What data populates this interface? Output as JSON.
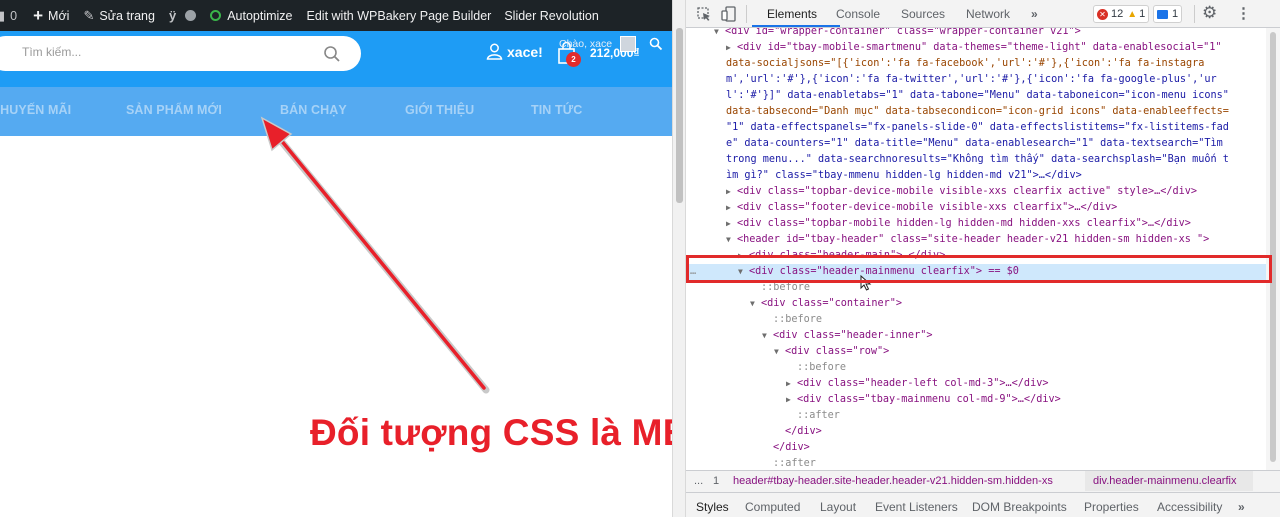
{
  "adminbar": {
    "comments_count": "0",
    "new_label": "Mới",
    "edit_label": "Sửa trang",
    "autoptimize_label": "Autoptimize",
    "wpbakery_label": "Edit with WPBakery Page Builder",
    "slider_label": "Slider Revolution"
  },
  "header": {
    "search_placeholder": "Tìm kiếm...",
    "account_name": "xace!",
    "cart_greeting": "Chào, xace",
    "cart_count": "2",
    "cart_total": "212,000₫"
  },
  "nav": {
    "items": [
      "KHUYẾN MÃI",
      "SẢN PHẨM MỚI",
      "BÁN CHẠY",
      "GIỚI THIỆU",
      "TIN TỨC"
    ]
  },
  "annotation": {
    "caption": "Đối tượng CSS là MENU",
    "color": "#e8202a"
  },
  "devtools": {
    "tabs": [
      "Elements",
      "Console",
      "Sources",
      "Network",
      "»"
    ],
    "errors": "12",
    "warnings": "1",
    "messages": "1",
    "dom_lines": [
      "<div id=\"wrapper-container\" class=\"wrapper-container v21\">",
      "<div id=\"tbay-mobile-smartmenu\" data-themes=\"theme-light\" data-enablesocial=\"1\"",
      "data-socialjsons=\"[{'icon':'fa fa-facebook','url':'#'},{'icon':'fa fa-instagra",
      "m','url':'#'},{'icon':'fa fa-twitter','url':'#'},{'icon':'fa fa-google-plus','ur",
      "l':'#'}]\" data-enabletabs=\"1\" data-tabone=\"Menu\" data-taboneicon=\"icon-menu icons\"",
      "data-tabsecond=\"Danh mục\" data-tabsecondicon=\"icon-grid icons\" data-enableeffects=",
      "\"1\" data-effectspanels=\"fx-panels-slide-0\" data-effectslistitems=\"fx-listitems-fad",
      "e\" data-counters=\"1\" data-title=\"Menu\" data-enablesearch=\"1\" data-textsearch=\"Tìm",
      "trong menu...\" data-searchnoresults=\"Không tìm thấy\" data-searchsplash=\"Bạn muốn t",
      "ìm gì?\" class=\"tbay-mmenu hidden-lg hidden-md v21\">…</div>",
      "<div class=\"topbar-device-mobile visible-xxs clearfix active\" style>…</div>",
      "<div class=\"footer-device-mobile visible-xxs clearfix\">…</div>",
      "<div class=\"topbar-mobile  hidden-lg hidden-md  hidden-xxs clearfix\">…</div>",
      "<header id=\"tbay-header\" class=\"site-header header-v21 hidden-sm hidden-xs \">",
      "<div class=\"header-main\">…</div>",
      "<div class=\"header-mainmenu clearfix\"> == $0",
      "::before",
      "<div class=\"container\">",
      "::before",
      "<div class=\"header-inner\">",
      "<div class=\"row\">",
      "::before",
      "<div class=\"header-left col-md-3\">…</div>",
      "<div class=\"tbay-mainmenu col-md-9\">…</div>",
      "::after",
      "</div>",
      "</div>",
      "::after"
    ],
    "breadcrumb": [
      "...",
      "1",
      "header#tbay-header.site-header.header-v21.hidden-sm.hidden-xs",
      "div.header-mainmenu.clearfix"
    ],
    "bottom_tabs": [
      "Styles",
      "Computed",
      "Layout",
      "Event Listeners",
      "DOM Breakpoints",
      "Properties",
      "Accessibility",
      "»"
    ]
  }
}
